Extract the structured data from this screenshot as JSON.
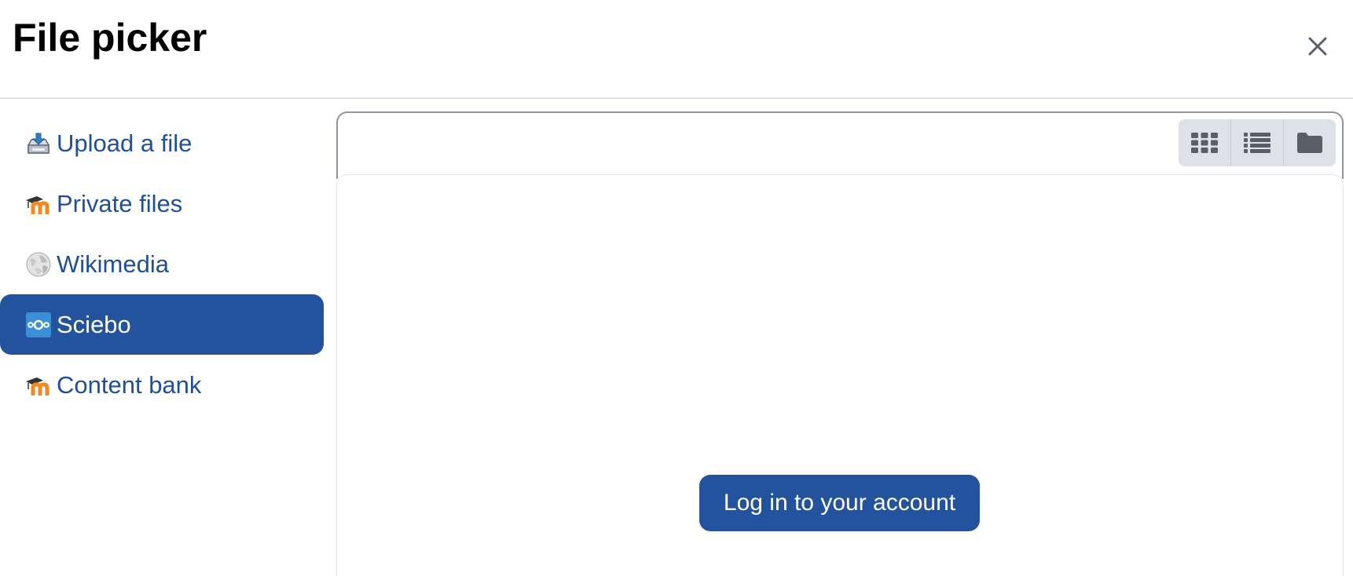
{
  "dialog": {
    "title": "File picker"
  },
  "sidebar": {
    "items": [
      {
        "label": "Upload a file",
        "icon": "upload-icon",
        "active": false
      },
      {
        "label": "Private files",
        "icon": "moodle-icon",
        "active": false
      },
      {
        "label": "Wikimedia",
        "icon": "wikimedia-globe-icon",
        "active": false
      },
      {
        "label": "Sciebo",
        "icon": "sciebo-icon",
        "active": true
      },
      {
        "label": "Content bank",
        "icon": "moodle-icon",
        "active": false
      }
    ]
  },
  "toolbar": {
    "views": [
      {
        "icon": "grid-view-icon",
        "active": false
      },
      {
        "icon": "list-view-icon",
        "active": false
      },
      {
        "icon": "folder-view-icon",
        "active": false
      }
    ]
  },
  "main": {
    "login_label": "Log in to your account"
  },
  "colors": {
    "accent": "#22539c",
    "link": "#1f4e9b",
    "toolbar_bg": "#dee2e6",
    "icon_gray": "#595f66"
  }
}
